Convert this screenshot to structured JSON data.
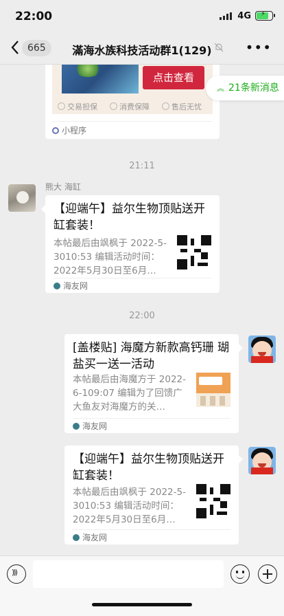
{
  "status": {
    "time": "22:00",
    "network": "4G"
  },
  "nav": {
    "back_count": "665",
    "title": "滿海水族科技活动群1(129)"
  },
  "new_messages": "21条新消息",
  "miniprogram": {
    "button": "点击查看",
    "badges": [
      "交易担保",
      "消费保障",
      "售后无忧"
    ],
    "footer": "小程序"
  },
  "messages": [
    {
      "time": "21:11"
    },
    {
      "sender": "熊大 海缸",
      "title": "【迎端午】益尔生物顶贴送开缸套装！",
      "desc": "本帖最后由飒枫于 2022-5-3010:53 编辑活动时间：2022年5月30日至6月…",
      "source": "海友网"
    },
    {
      "time": "22:00"
    },
    {
      "title": "[盖楼贴] 海魔方新款高钙珊 瑚盐买一送一活动",
      "desc": "本帖最后由海魔方于 2022-6-109:07 编辑为了回馈广大鱼友对海魔方的关…",
      "source": "海友网"
    },
    {
      "title": "【迎端午】益尔生物顶贴送开缸套装！",
      "desc": "本帖最后由飒枫于 2022-5-3010:53 编辑活动时间：2022年5月30日至6月…",
      "source": "海友网"
    }
  ],
  "colors": {
    "accent_green": "#1aad19",
    "button_red": "#d1273e",
    "background": "#ededed"
  }
}
